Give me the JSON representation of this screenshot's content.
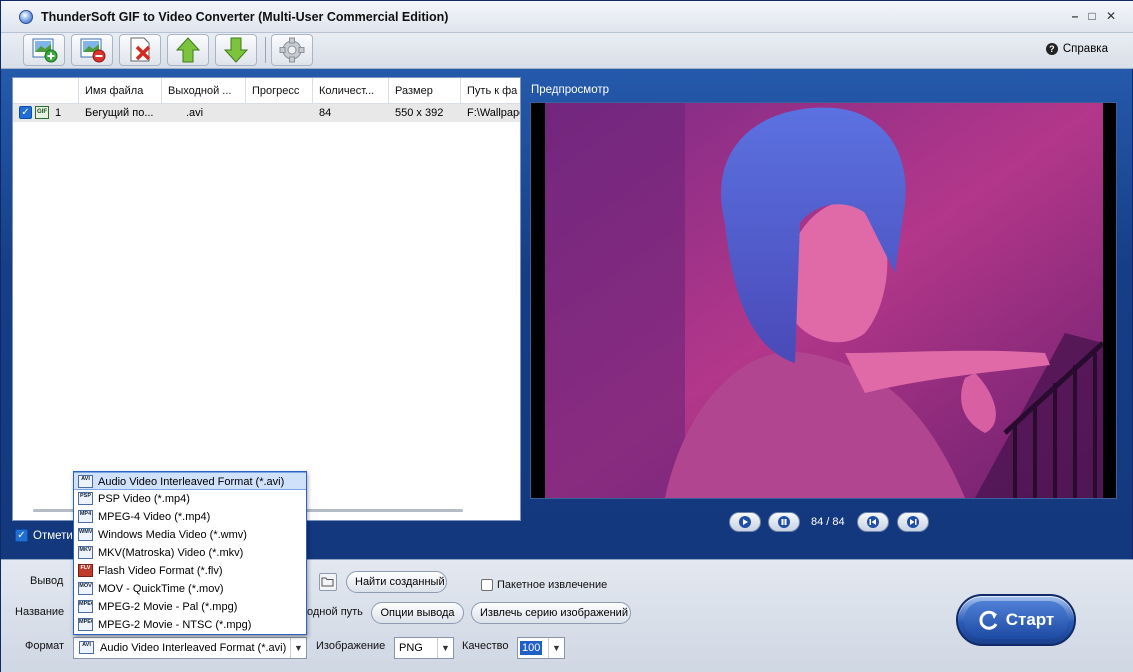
{
  "window": {
    "title": "ThunderSoft GIF to Video Converter (Multi-User Commercial Edition)",
    "controls": {
      "minimize": "–",
      "maximize": "□",
      "close": "✕"
    }
  },
  "toolbar": {
    "buttons": [
      "add-image-icon",
      "remove-image-icon",
      "delete-icon",
      "move-up-icon",
      "move-down-icon",
      "settings-gear-icon"
    ],
    "help_label": "Справка",
    "help_icon": "?"
  },
  "file_list": {
    "columns": [
      "",
      "Имя файла",
      "Выходной ...",
      "Прогресс",
      "Количест...",
      "Размер",
      "Путь к фа"
    ],
    "rows": [
      {
        "index": "1",
        "name": "Бегущий по...",
        "output": ".avi",
        "progress": "",
        "count": "84",
        "size": "550 x 392",
        "path": "F:\\Wallpaper"
      }
    ]
  },
  "mark_all": {
    "label": "Отметит"
  },
  "preview": {
    "label": "Предпросмотр",
    "frame_counter": "84 / 84",
    "tint": "#b0358c"
  },
  "bottom": {
    "output_label": "Вывод",
    "name_label": "Название",
    "format_label": "Формат",
    "find_created": "Найти созданный",
    "batch_extract": "Пакетное извлечение",
    "source_path": "одной путь",
    "output_options": "Опции вывода",
    "extract_series": "Извлечь серию изображений",
    "image_label": "Изображение",
    "image_value": "PNG",
    "quality_label": "Качество",
    "quality_value": "100",
    "format_value": "Audio Video Interleaved Format (*.avi)",
    "format_icon_text": "AVI",
    "start_label": "Старт"
  },
  "format_dropdown": [
    {
      "icon": "AVI",
      "label": "Audio Video Interleaved Format (*.avi)"
    },
    {
      "icon": "PSP",
      "label": "PSP Video (*.mp4)"
    },
    {
      "icon": "MP4",
      "label": "MPEG-4 Video (*.mp4)"
    },
    {
      "icon": "WMV",
      "label": "Windows Media Video (*.wmv)"
    },
    {
      "icon": "MKV",
      "label": "MKV(Matroska) Video (*.mkv)"
    },
    {
      "icon": "FLV",
      "label": "Flash Video Format (*.flv)"
    },
    {
      "icon": "MOV",
      "label": "MOV - QuickTime (*.mov)"
    },
    {
      "icon": "MPEG2",
      "label": "MPEG-2 Movie - Pal (*.mpg)"
    },
    {
      "icon": "MPEG2",
      "label": "MPEG-2 Movie - NTSC (*.mpg)"
    }
  ],
  "colors": {
    "accent": "#1f5fc6",
    "window_bg": "#163e86",
    "selection": "#cfe1fb"
  }
}
